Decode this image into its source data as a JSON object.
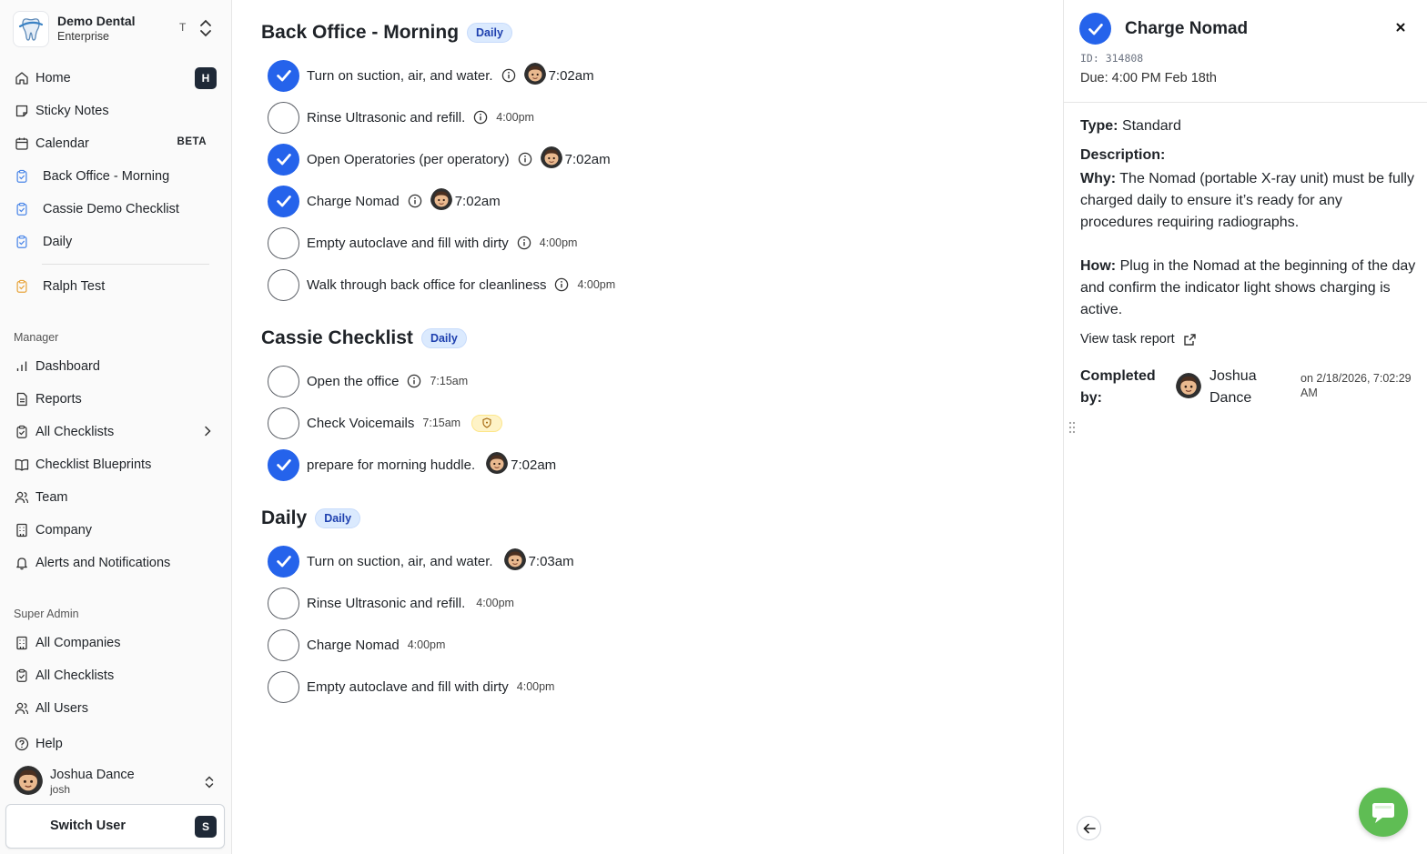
{
  "org": {
    "name": "Demo Dental",
    "plan": "Enterprise",
    "initial": "T"
  },
  "nav": {
    "home": "Home",
    "home_key": "H",
    "sticky": "Sticky Notes",
    "calendar": "Calendar",
    "calendar_badge": "BETA",
    "cl1": "Back Office - Morning",
    "cl2": "Cassie Demo Checklist",
    "cl3": "Daily",
    "cl4": "Ralph Test"
  },
  "manager": {
    "label": "Manager",
    "dashboard": "Dashboard",
    "reports": "Reports",
    "all_checklists": "All Checklists",
    "blueprints": "Checklist Blueprints",
    "team": "Team",
    "company": "Company",
    "alerts": "Alerts and Notifications"
  },
  "super_admin": {
    "label": "Super Admin",
    "companies": "All Companies",
    "checklists": "All Checklists",
    "users": "All Users"
  },
  "help": "Help",
  "user": {
    "name": "Joshua Dance",
    "handle": "josh"
  },
  "switch_user": {
    "label": "Switch User",
    "key": "S"
  },
  "groups": [
    {
      "title": "Back Office - Morning",
      "badge": "Daily",
      "tasks": [
        {
          "label": "Turn on suction, air, and water.",
          "time": "7:02am"
        },
        {
          "label": "Rinse Ultrasonic and refill.",
          "time": "4:00pm"
        },
        {
          "label": "Open Operatories (per operatory)",
          "time": "7:02am"
        },
        {
          "label": "Charge Nomad",
          "time": "7:02am"
        },
        {
          "label": "Empty autoclave and fill with dirty",
          "time": "4:00pm"
        },
        {
          "label": "Walk through back office for cleanliness",
          "time": "4:00pm"
        }
      ]
    },
    {
      "title": "Cassie Checklist",
      "badge": "Daily",
      "tasks": [
        {
          "label": "Open the office",
          "time": "7:15am"
        },
        {
          "label": "Check Voicemails",
          "time": "7:15am"
        },
        {
          "label": "prepare for morning huddle.",
          "time": "7:02am"
        }
      ]
    },
    {
      "title": "Daily",
      "badge": "Daily",
      "tasks": [
        {
          "label": "Turn on suction, air, and water.",
          "time": "7:03am"
        },
        {
          "label": "Rinse Ultrasonic and refill.",
          "time": "4:00pm"
        },
        {
          "label": "Charge Nomad",
          "time": "4:00pm"
        },
        {
          "label": "Empty autoclave and fill with dirty",
          "time": "4:00pm"
        }
      ]
    }
  ],
  "panel": {
    "title": "Charge Nomad",
    "id": "ID: 314808",
    "due": "Due: 4:00 PM Feb 18th",
    "type_label": "Type:",
    "type_value": "Standard",
    "desc_label": "Description:",
    "why_label": "Why:",
    "why_text": "The Nomad (portable X-ray unit) must be fully charged daily to ensure it’s ready for any procedures requiring radiographs.",
    "how_label": "How:",
    "how_text": "Plug in the Nomad at the beginning of the day and confirm the indicator light shows charging is active.",
    "report_link": "View task report",
    "completed_label": "Completed by:",
    "completed_name": "Joshua Dance",
    "completed_time": "on 2/18/2026, 7:02:29 AM"
  },
  "colors": {
    "accent": "#2563eb",
    "badge_bg": "#dbeafe",
    "chat": "#5fbd54"
  }
}
